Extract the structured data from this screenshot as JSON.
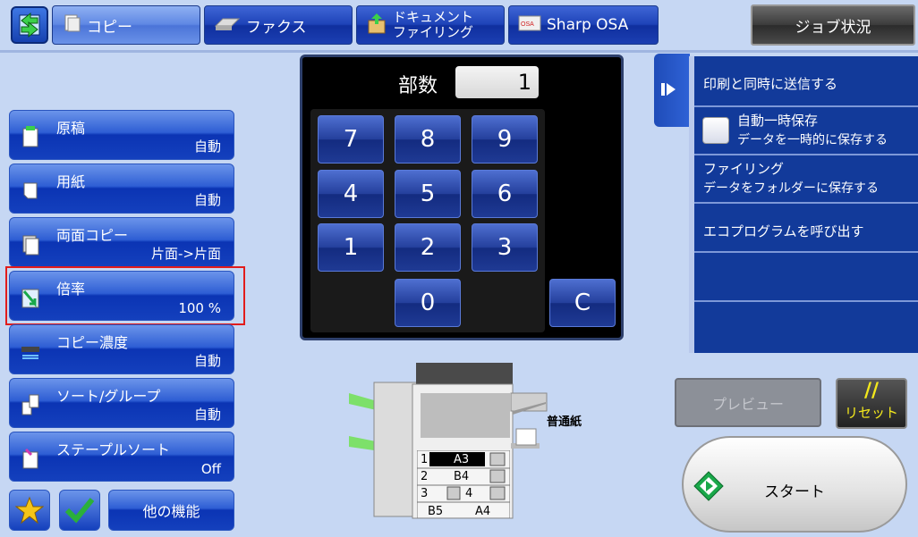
{
  "tabs": [
    {
      "label": "コピー",
      "icon": "copy-icon",
      "active": true
    },
    {
      "label": "ファクス",
      "icon": "fax-icon",
      "active": false
    },
    {
      "label_line1": "ドキュメント",
      "label_line2": "ファイリング",
      "icon": "document-filing-icon",
      "active": false
    },
    {
      "label": "Sharp OSA",
      "icon": "osa-icon",
      "active": false
    }
  ],
  "job_status": "ジョブ状況",
  "settings": [
    {
      "label": "原稿",
      "value": "自動",
      "icon": "original-icon"
    },
    {
      "label": "用紙",
      "value": "自動",
      "icon": "paper-icon"
    },
    {
      "label": "両面コピー",
      "value": "片面->片面",
      "icon": "duplex-icon"
    },
    {
      "label": "倍率",
      "value": "100 %",
      "icon": "ratio-icon"
    },
    {
      "label": "コピー濃度",
      "value": "自動",
      "icon": "exposure-icon"
    },
    {
      "label": "ソート/グループ",
      "value": "自動",
      "icon": "sort-icon"
    },
    {
      "label": "ステープルソート",
      "value": "Off",
      "icon": "staple-icon"
    }
  ],
  "bottom_left": {
    "more_label": "他の機能"
  },
  "keypad": {
    "copies_label": "部数",
    "copies_value": "1",
    "keys": [
      "7",
      "8",
      "9",
      "4",
      "5",
      "6",
      "1",
      "2",
      "3",
      "0"
    ],
    "clear": "C"
  },
  "right_panel": {
    "items": [
      {
        "line1": "印刷と同時に送信する"
      },
      {
        "line1": "自動一時保存",
        "line2": "データを一時的に保存する"
      },
      {
        "line1": "ファイリング",
        "line2": "データをフォルダーに保存する"
      },
      {
        "line1": "エコプログラムを呼び出す"
      }
    ]
  },
  "preview_label": "プレビュー",
  "reset_label": "リセット",
  "reset_mark": "//",
  "start_label": "スタート",
  "machine": {
    "paper_type": "普通紙",
    "trays": [
      {
        "num": "1",
        "size": "A3"
      },
      {
        "num": "2",
        "size": "B4"
      },
      {
        "num": "3",
        "size": "B5"
      },
      {
        "num": "4",
        "size": "A4"
      }
    ]
  },
  "colors": {
    "accent": "#1440bd",
    "panel": "#123a9a",
    "highlight": "#e21c1c",
    "start_icon": "#1aa84a",
    "reset_text": "#f3e81c"
  }
}
